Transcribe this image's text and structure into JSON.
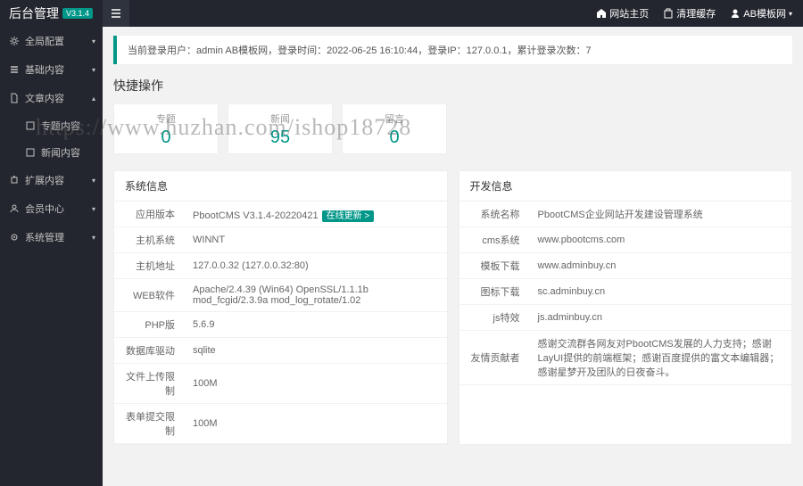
{
  "header": {
    "title": "后台管理",
    "version": "V3.1.4",
    "links": {
      "home": "网站主页",
      "cache": "清理缓存",
      "user": "AB模板网"
    }
  },
  "sidebar": {
    "items": [
      {
        "icon": "gear",
        "label": "全局配置",
        "caret": "▾"
      },
      {
        "icon": "list",
        "label": "基础内容",
        "caret": "▾"
      },
      {
        "icon": "file",
        "label": "文章内容",
        "caret": "▴",
        "sub": [
          {
            "icon": "doc",
            "label": "专题内容"
          },
          {
            "icon": "doc",
            "label": "新闻内容"
          }
        ]
      },
      {
        "icon": "puzzle",
        "label": "扩展内容",
        "caret": "▾"
      },
      {
        "icon": "users",
        "label": "会员中心",
        "caret": "▾"
      },
      {
        "icon": "cog",
        "label": "系统管理",
        "caret": "▾"
      }
    ]
  },
  "loginInfo": "当前登录用户：admin AB模板网，登录时间：2022-06-25 16:10:44，登录IP：127.0.0.1，累计登录次数：7",
  "quickTitle": "快捷操作",
  "stats": [
    {
      "label": "专题",
      "value": "0"
    },
    {
      "label": "新闻",
      "value": "95"
    },
    {
      "label": "留言",
      "value": "0"
    }
  ],
  "sysPanel": {
    "title": "系统信息",
    "rows": [
      {
        "k": "应用版本",
        "v": "PbootCMS V3.1.4-20220421",
        "badge": "在线更新 >"
      },
      {
        "k": "主机系统",
        "v": "WINNT"
      },
      {
        "k": "主机地址",
        "v": "127.0.0.32 (127.0.0.32:80)"
      },
      {
        "k": "WEB软件",
        "v": "Apache/2.4.39 (Win64) OpenSSL/1.1.1b mod_fcgid/2.3.9a mod_log_rotate/1.02"
      },
      {
        "k": "PHP版",
        "v": "5.6.9"
      },
      {
        "k": "数据库驱动",
        "v": "sqlite"
      },
      {
        "k": "文件上传限制",
        "v": "100M"
      },
      {
        "k": "表单提交限制",
        "v": "100M"
      }
    ]
  },
  "devPanel": {
    "title": "开发信息",
    "rows": [
      {
        "k": "系统名称",
        "v": "PbootCMS企业网站开发建设管理系统"
      },
      {
        "k": "cms系统",
        "v": "www.pbootcms.com"
      },
      {
        "k": "模板下载",
        "v": "www.adminbuy.cn"
      },
      {
        "k": "图标下载",
        "v": "sc.adminbuy.cn"
      },
      {
        "k": "js特效",
        "v": "js.adminbuy.cn"
      },
      {
        "k": "友情贡献者",
        "v": "感谢交流群各网友对PbootCMS发展的人力支持；感谢LayUI提供的前端框架；感谢百度提供的富文本编辑器；感谢星梦开及团队的日夜奋斗。"
      }
    ]
  },
  "watermark": "https://www.huzhan.com/ishop18728"
}
